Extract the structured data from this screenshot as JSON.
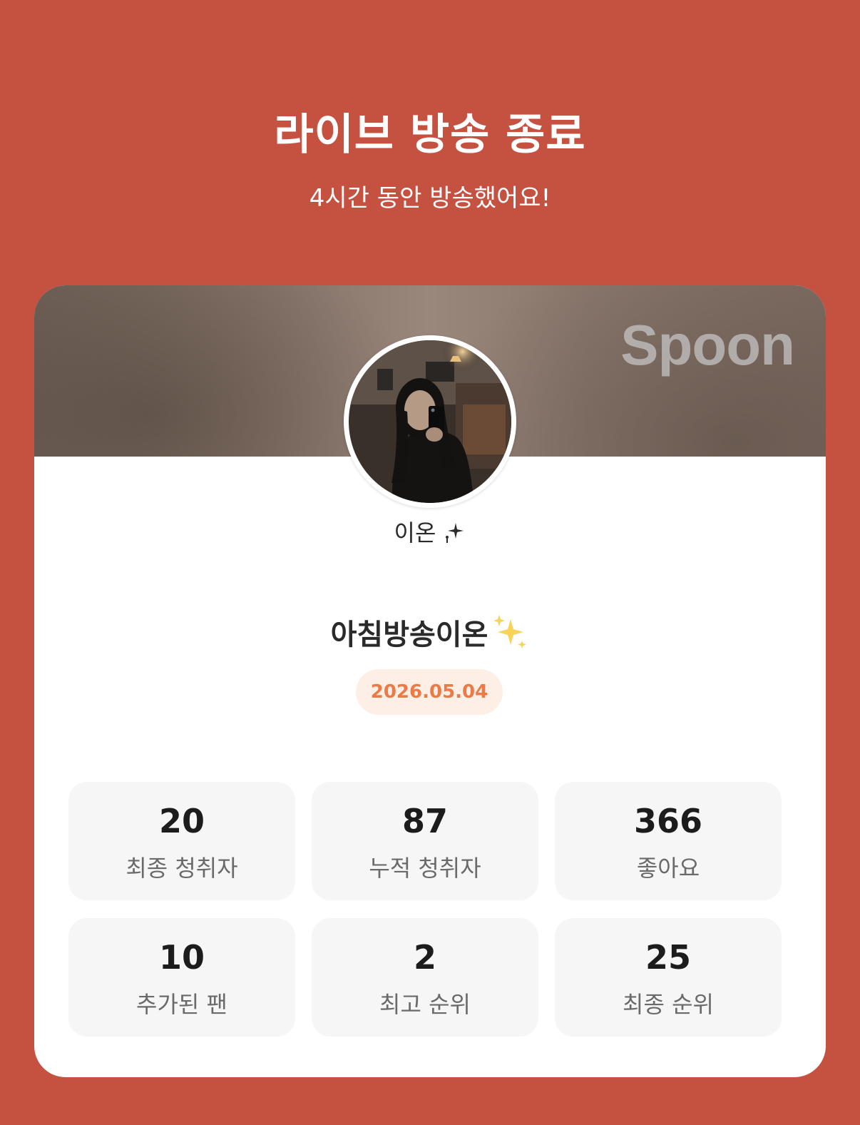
{
  "header": {
    "title": "라이브 방송 종료",
    "subtitle": "4시간 동안 방송했어요!"
  },
  "card": {
    "brand": "Spoon",
    "nickname": "이온",
    "broadcast_title": "아침방송이온",
    "date": "2026.05.04"
  },
  "stats": [
    {
      "value": "20",
      "label": "최종 청취자"
    },
    {
      "value": "87",
      "label": "누적 청취자"
    },
    {
      "value": "366",
      "label": "좋아요"
    },
    {
      "value": "10",
      "label": "추가된 팬"
    },
    {
      "value": "2",
      "label": "최고 순위"
    },
    {
      "value": "25",
      "label": "최종 순위"
    }
  ],
  "colors": {
    "background": "#c55241",
    "accent": "#ea7a46",
    "date_badge_bg": "#fdeee6",
    "stat_tile_bg": "#f6f6f6"
  },
  "icons": {
    "nickname_decoration": "sparkle-icon",
    "title_decoration": "sparkles-emoji-icon"
  }
}
